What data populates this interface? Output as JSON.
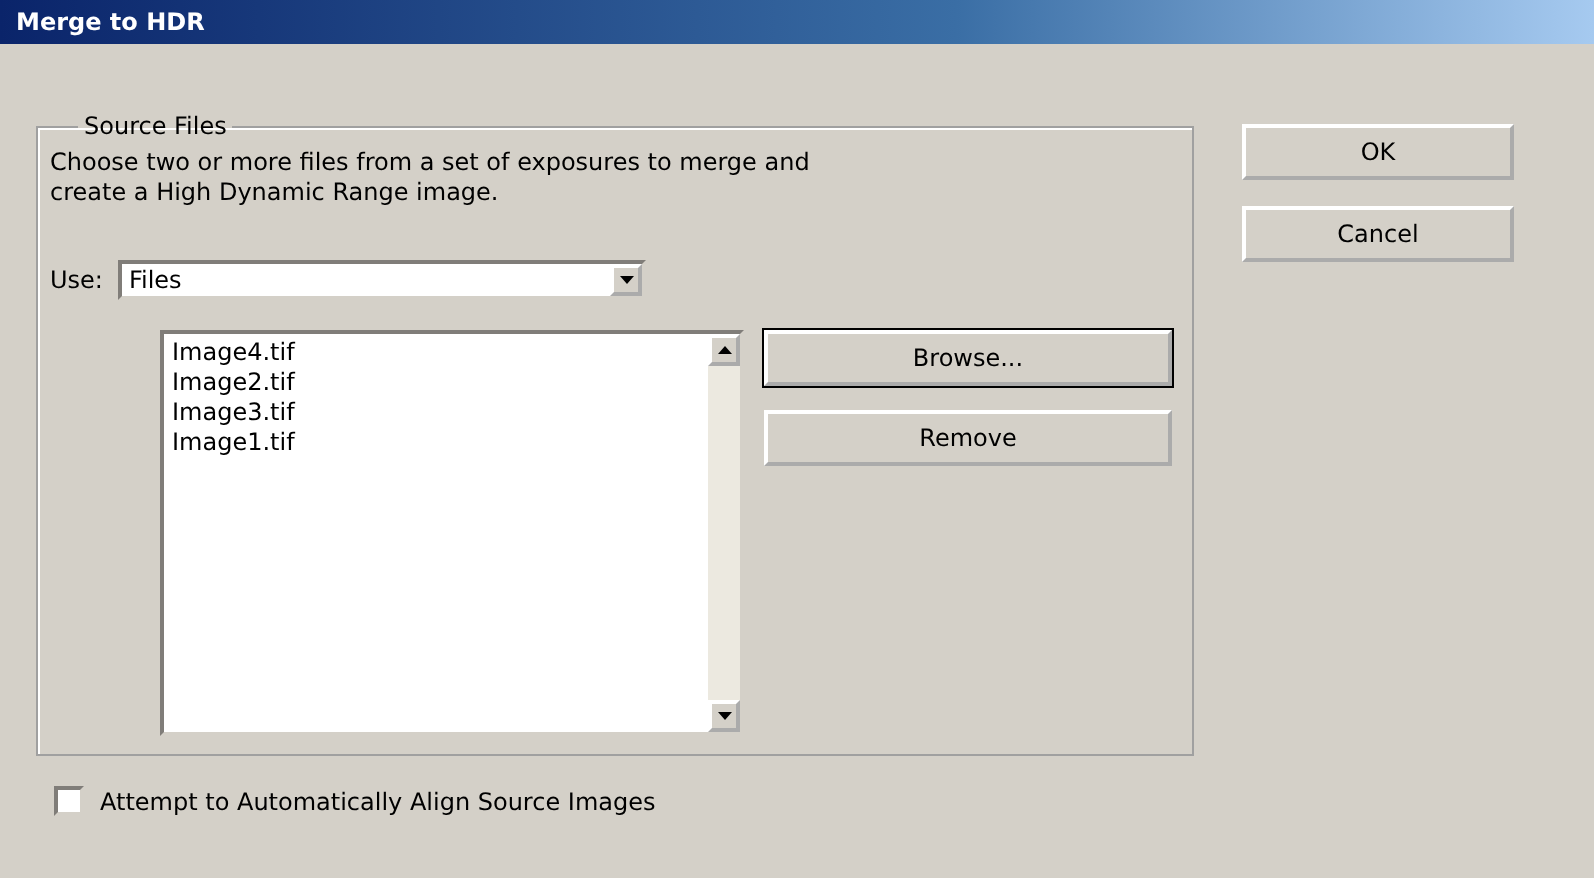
{
  "window": {
    "title": "Merge to HDR"
  },
  "source_files": {
    "legend": "Source Files",
    "description": "Choose two or more files from a set of exposures to merge and create a High Dynamic Range image.",
    "use_label": "Use:",
    "use_value": "Files",
    "files": [
      "Image4.tif",
      "Image2.tif",
      "Image3.tif",
      "Image1.tif"
    ],
    "side_buttons": [
      {
        "label": "Browse...",
        "selected": true
      },
      {
        "label": "Remove",
        "selected": false
      }
    ]
  },
  "buttons": [
    "OK",
    "Cancel"
  ],
  "align": {
    "label": "Attempt to Automatically Align Source Images",
    "checked": false
  }
}
